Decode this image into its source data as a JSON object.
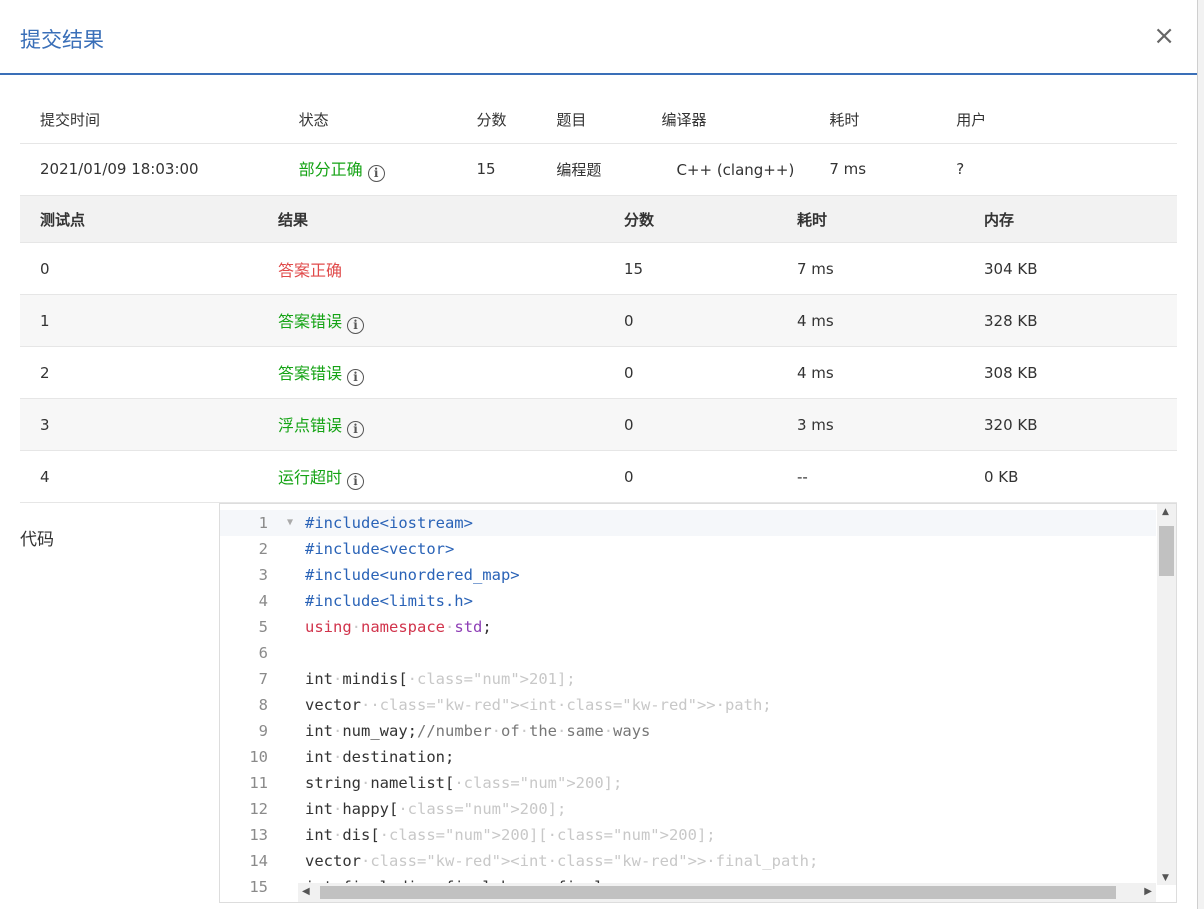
{
  "modal": {
    "title": "提交结果",
    "close_label": "×"
  },
  "summary": {
    "headers": [
      "提交时间",
      "状态",
      "分数",
      "题目",
      "编译器",
      "耗时",
      "用户"
    ],
    "row": {
      "time": "2021/01/09 18:03:00",
      "status": "部分正确",
      "score": "15",
      "problem": "编程题",
      "compiler": "C++ (clang++)",
      "elapsed": "7 ms",
      "user": "?"
    }
  },
  "testcases": {
    "headers": [
      "测试点",
      "结果",
      "分数",
      "耗时",
      "内存"
    ],
    "rows": [
      {
        "id": "0",
        "result": "答案正确",
        "score": "15",
        "time": "7 ms",
        "memory": "304 KB",
        "color": "#e04b4b"
      },
      {
        "id": "1",
        "result": "答案错误",
        "score": "0",
        "time": "4 ms",
        "memory": "328 KB",
        "color": "#14a314"
      },
      {
        "id": "2",
        "result": "答案错误",
        "score": "0",
        "time": "4 ms",
        "memory": "308 KB",
        "color": "#14a314"
      },
      {
        "id": "3",
        "result": "浮点错误",
        "score": "0",
        "time": "3 ms",
        "memory": "320 KB",
        "color": "#14a314"
      },
      {
        "id": "4",
        "result": "运行超时",
        "score": "0",
        "time": "--",
        "memory": "0 KB",
        "color": "#14a314"
      }
    ]
  },
  "code": {
    "label": "代码",
    "line_numbers": [
      "1",
      "2",
      "3",
      "4",
      "5",
      "6",
      "7",
      "8",
      "9",
      "10",
      "11",
      "12",
      "13",
      "14",
      "15"
    ],
    "lines": [
      "#include<iostream>",
      "#include<vector>",
      "#include<unordered_map>",
      "#include<limits.h>",
      "using namespace std;",
      "",
      "int mindis[201];",
      "vector <int> path;",
      "int num_way;//number of the same ways",
      "int destination;",
      "string namelist[200];",
      "int happy[200];",
      "int dis[200][200];",
      "vector<int> final_path;",
      "int final_diss,final_happy,final_avg;"
    ]
  },
  "colors": {
    "accent": "#3a6fb8",
    "correct_status": "#14a314",
    "accepted_case": "#e04b4b"
  }
}
